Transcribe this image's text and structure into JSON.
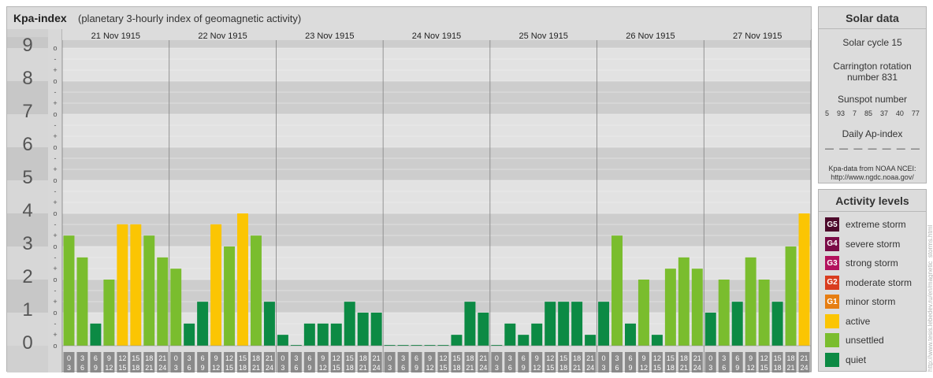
{
  "header": {
    "title": "Kpa-index",
    "subtitle": "(planetary 3-hourly index of geomagnetic activity)"
  },
  "chart_data": {
    "type": "bar",
    "y_label_levels": [
      "0",
      "1",
      "2",
      "3",
      "4",
      "5",
      "6",
      "7",
      "8",
      "9"
    ],
    "sub_ticks": [
      "+",
      "o",
      "-"
    ],
    "ylim": [
      0,
      9.33
    ],
    "days": [
      "21 Nov 1915",
      "22 Nov 1915",
      "23 Nov 1915",
      "24 Nov 1915",
      "25 Nov 1915",
      "26 Nov 1915",
      "27 Nov 1915"
    ],
    "interval_starts": [
      "0",
      "3",
      "6",
      "9",
      "12",
      "15",
      "18",
      "21"
    ],
    "interval_ends": [
      "3",
      "6",
      "9",
      "12",
      "15",
      "18",
      "21",
      "24"
    ],
    "values": [
      [
        3.33,
        2.67,
        0.67,
        2.0,
        3.67,
        3.67,
        3.33,
        2.67
      ],
      [
        2.33,
        0.67,
        1.33,
        3.67,
        3.0,
        4.0,
        3.33,
        1.33
      ],
      [
        0.33,
        0.0,
        0.67,
        0.67,
        0.67,
        1.33,
        1.0,
        1.0
      ],
      [
        0.0,
        0.0,
        0.0,
        0.0,
        0.0,
        0.33,
        1.33,
        1.0
      ],
      [
        0.0,
        0.67,
        0.33,
        0.67,
        1.33,
        1.33,
        1.33,
        0.33
      ],
      [
        1.33,
        3.33,
        0.67,
        2.0,
        0.33,
        2.33,
        2.67,
        2.33
      ],
      [
        1.0,
        2.0,
        1.33,
        2.67,
        2.0,
        1.33,
        3.0,
        4.0
      ]
    ],
    "colors": {
      "quiet": "#0c8a44",
      "unsettled": "#7abd2e",
      "active": "#fbc503"
    },
    "grid": true
  },
  "solar": {
    "title": "Solar data",
    "cycle": "Solar cycle 15",
    "carrington_line1": "Carrington rotation",
    "carrington_line2": "number 831",
    "sunspot_title": "Sunspot number",
    "sunspots": [
      "5",
      "93",
      "7",
      "85",
      "37",
      "40",
      "77"
    ],
    "ap_title": "Daily Ap-index",
    "ap_values": [
      "—",
      "—",
      "—",
      "—",
      "—",
      "—",
      "—"
    ],
    "source_line1": "Kpa-data from NOAA NCEI:",
    "source_line2": "http://www.ngdc.noaa.gov/"
  },
  "levels": {
    "title": "Activity levels",
    "items": [
      {
        "code": "G5",
        "label": "extreme storm",
        "color": "#4d0a2b"
      },
      {
        "code": "G4",
        "label": "severe storm",
        "color": "#7a0b46"
      },
      {
        "code": "G3",
        "label": "strong storm",
        "color": "#b3125d"
      },
      {
        "code": "G2",
        "label": "moderate storm",
        "color": "#d93d1f"
      },
      {
        "code": "G1",
        "label": "minor storm",
        "color": "#e67e12"
      },
      {
        "code": "",
        "label": "active",
        "color": "#fbc503"
      },
      {
        "code": "",
        "label": "unsettled",
        "color": "#7abd2e"
      },
      {
        "code": "",
        "label": "quiet",
        "color": "#0c8a44"
      }
    ]
  },
  "credit": "http://www.tesis.lebedev.ru/en/magnetic_storms.html"
}
